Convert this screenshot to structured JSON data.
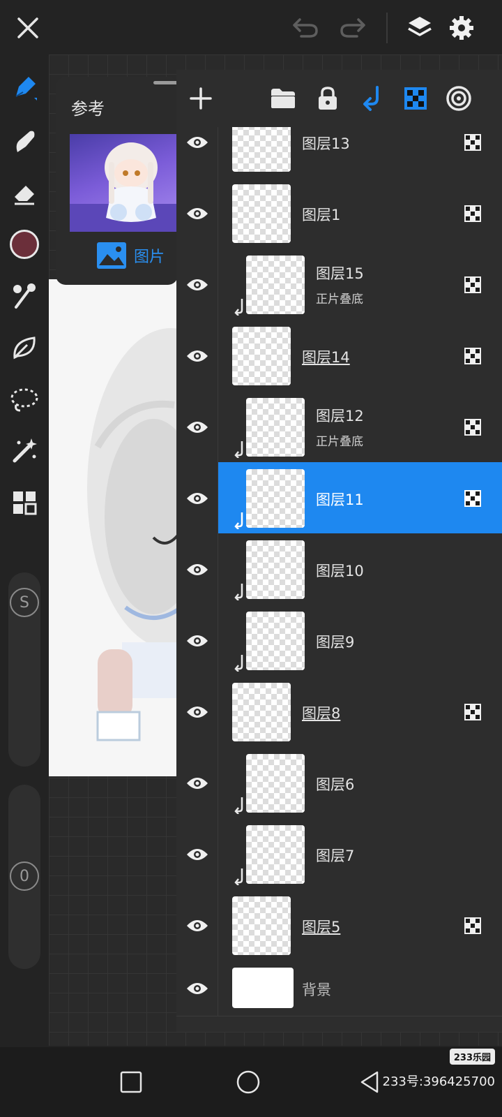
{
  "colors": {
    "accent": "#1e88f0",
    "panel": "#2d2d2d",
    "current_brush_color": "#6b2f3a"
  },
  "topbar": {
    "icons": [
      "close-icon",
      "undo-icon",
      "redo-icon",
      "layers-icon",
      "settings-icon"
    ]
  },
  "tools": {
    "items": [
      "pen-icon",
      "smudge-icon",
      "eraser-icon",
      "color-swatch",
      "brush-icon",
      "leaf-icon",
      "lasso-icon",
      "magic-wand-icon",
      "grid-icon"
    ],
    "size_slider_label": "S",
    "opacity_slider_value": "0"
  },
  "reference": {
    "title": "参考",
    "image_button_label": "图片"
  },
  "layers_toolbar": {
    "icons": [
      "add-icon",
      "folder-icon",
      "lock-icon",
      "clip-icon",
      "alpha-lock-icon",
      "blend-icon"
    ]
  },
  "layers": [
    {
      "name": "图层13",
      "mode": "",
      "clipped": false,
      "alpha": true,
      "underline": false,
      "selected": false
    },
    {
      "name": "图层1",
      "mode": "",
      "clipped": false,
      "alpha": true,
      "underline": false,
      "selected": false
    },
    {
      "name": "图层15",
      "mode": "正片叠底",
      "clipped": true,
      "alpha": true,
      "underline": false,
      "selected": false
    },
    {
      "name": "图层14",
      "mode": "",
      "clipped": false,
      "alpha": true,
      "underline": true,
      "selected": false
    },
    {
      "name": "图层12",
      "mode": "正片叠底",
      "clipped": true,
      "alpha": true,
      "underline": false,
      "selected": false
    },
    {
      "name": "图层11",
      "mode": "",
      "clipped": true,
      "alpha": true,
      "underline": false,
      "selected": true
    },
    {
      "name": "图层10",
      "mode": "",
      "clipped": true,
      "alpha": false,
      "underline": false,
      "selected": false
    },
    {
      "name": "图层9",
      "mode": "",
      "clipped": true,
      "alpha": false,
      "underline": false,
      "selected": false
    },
    {
      "name": "图层8",
      "mode": "",
      "clipped": false,
      "alpha": true,
      "underline": true,
      "selected": false
    },
    {
      "name": "图层6",
      "mode": "",
      "clipped": true,
      "alpha": false,
      "underline": false,
      "selected": false
    },
    {
      "name": "图层7",
      "mode": "",
      "clipped": true,
      "alpha": false,
      "underline": false,
      "selected": false
    },
    {
      "name": "图层5",
      "mode": "",
      "clipped": false,
      "alpha": true,
      "underline": true,
      "selected": false
    },
    {
      "name": "背景",
      "mode": "",
      "clipped": false,
      "alpha": false,
      "underline": false,
      "selected": false,
      "background": true
    }
  ],
  "navbar": {
    "icons": [
      "recents-icon",
      "home-icon",
      "back-icon"
    ]
  },
  "watermark": {
    "badge": "233乐园",
    "id_text": "233号:396425700"
  }
}
